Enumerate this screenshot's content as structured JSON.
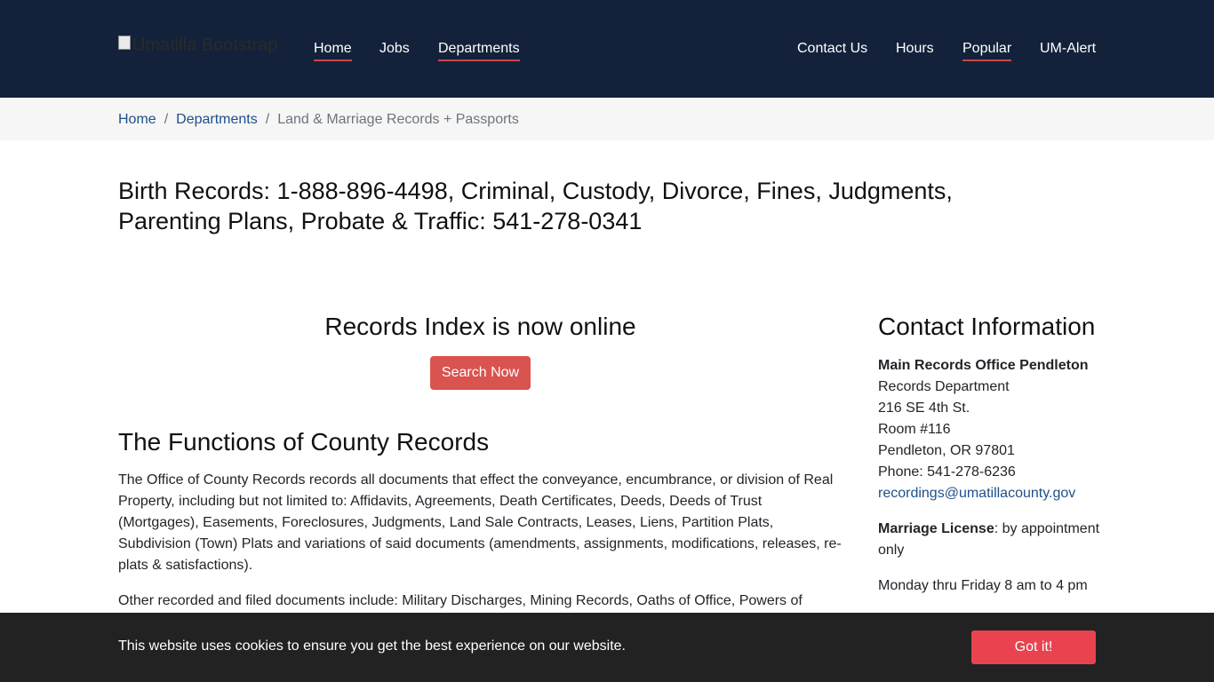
{
  "header": {
    "logo_alt": "Umatilla Bootstrap",
    "nav_left": [
      "Home",
      "Jobs",
      "Departments"
    ],
    "nav_right": [
      "Contact Us",
      "Hours",
      "Popular",
      "UM-Alert"
    ],
    "colors": {
      "background": "#13223a",
      "underline": "#c8474c"
    }
  },
  "breadcrumb": {
    "items": [
      "Home",
      "Departments"
    ],
    "current": "Land & Marriage Records + Passports",
    "separator": "/"
  },
  "headline": "Birth Records: 1-888-896-4498, Criminal, Custody, Divorce, Fines, Judgments, Parenting Plans, Probate & Traffic: 541-278-0341",
  "main": {
    "records_title": "Records Index is now online",
    "search_button": "Search Now",
    "functions_title": "The Functions of County Records",
    "paragraph1": "The Office of County Records records all documents that effect the conveyance, encumbrance, or division of Real Property, including but not limited to: Affidavits, Agreements, Death Certificates, Deeds, Deeds of Trust (Mortgages), Easements, Foreclosures, Judgments, Land Sale Contracts, Leases, Liens, Partition Plats, Subdivision (Town) Plats and variations of said documents (amendments, assignments, modifications, releases, re-plats & satisfactions).",
    "paragraph2": "Other recorded and filed documents include: Military Discharges, Mining Records, Oaths of Office, Powers of"
  },
  "contact": {
    "title": "Contact Information",
    "office_name": "Main Records Office Pendleton",
    "department": "Records Department",
    "street": "216 SE 4th St.",
    "room": "Room #116",
    "city": "Pendleton, OR 97801",
    "phone": "Phone: 541-278-6236",
    "email": "recordings@umatillacounty.gov",
    "marriage_label": "Marriage License",
    "marriage_text": ":  by appointment only",
    "hours": "Monday thru Friday 8 am to 4 pm"
  },
  "cookie": {
    "message": "This website uses cookies to ensure you get the best experience on our website.",
    "button": "Got it!",
    "colors": {
      "background": "#222222",
      "button": "#e8434e"
    }
  },
  "colors": {
    "link": "#1f4f8a",
    "search_button": "#d9534f"
  }
}
